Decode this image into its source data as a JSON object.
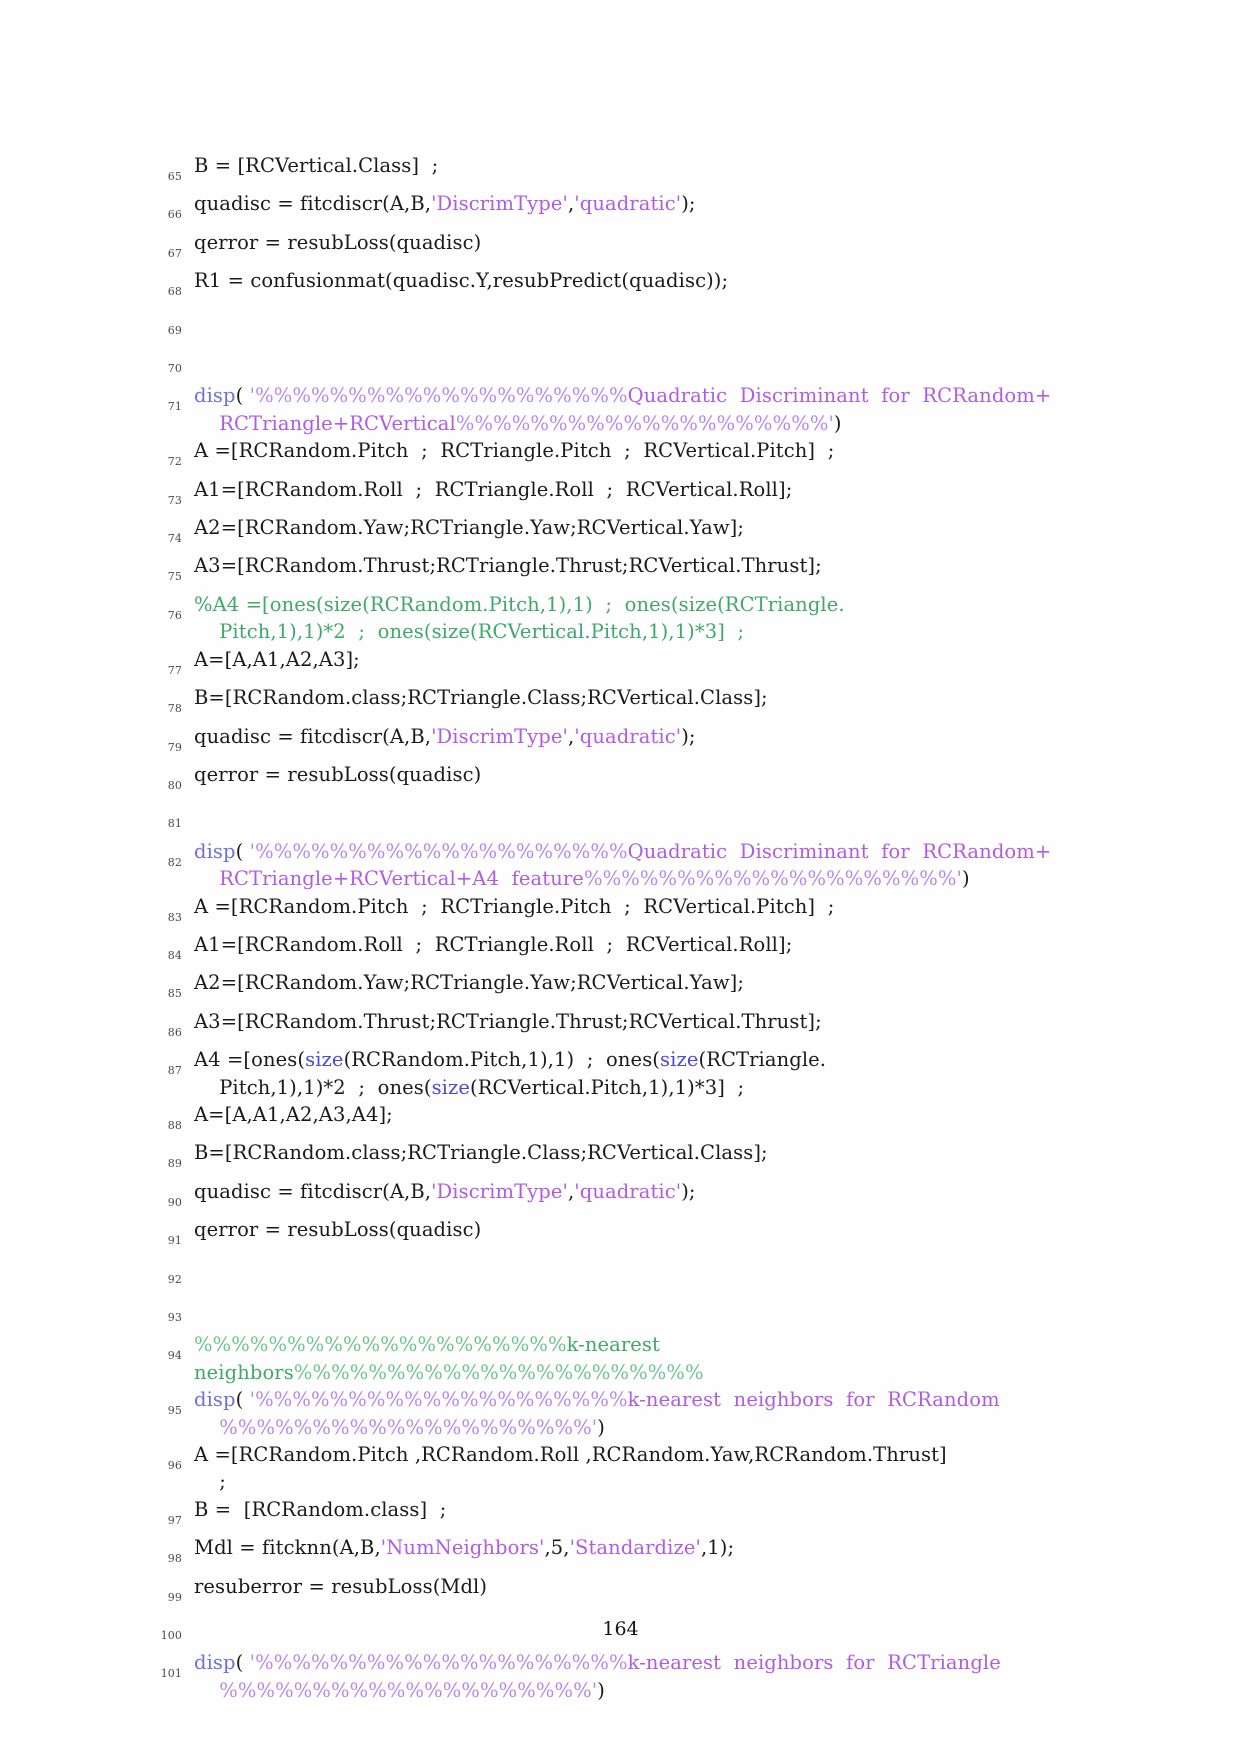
{
  "document": {
    "page_number": "164",
    "language": "MATLAB",
    "colors": {
      "text": "#1a1a1a",
      "keyword": "#4a4ad6",
      "string": "#b05ce0",
      "percent_string": "#b888e8",
      "comment": "#3fa86a",
      "function": "#6f6fe0",
      "line_number": "#4a4a4a"
    }
  },
  "listing": {
    "first_line_number": 65,
    "lines": [
      {
        "number": "65",
        "segments": [
          {
            "text": "B = [RCVertical.Class]  ;",
            "style": "plain"
          }
        ]
      },
      {
        "number": "66",
        "segments": [
          {
            "text": "quadisc = fitcdiscr(A,B,",
            "style": "plain"
          },
          {
            "text": "'DiscrimType'",
            "style": "string"
          },
          {
            "text": ",",
            "style": "plain"
          },
          {
            "text": "'quadratic'",
            "style": "string"
          },
          {
            "text": ");",
            "style": "plain"
          }
        ]
      },
      {
        "number": "67",
        "segments": [
          {
            "text": "qerror = resubLoss(quadisc)",
            "style": "plain"
          }
        ]
      },
      {
        "number": "68",
        "segments": [
          {
            "text": "R1 = confusionmat(quadisc.Y,resubPredict(quadisc));",
            "style": "plain"
          }
        ]
      },
      {
        "number": "69",
        "segments": []
      },
      {
        "number": "70",
        "segments": []
      },
      {
        "number": "71",
        "segments": [
          {
            "text": "disp",
            "style": "function"
          },
          {
            "text": "( ",
            "style": "plain"
          },
          {
            "text": "'%%%%%%%%%%%%%%%%%%%%",
            "style": "percent-string"
          },
          {
            "text": "Quadratic  Discriminant  for  RCRandom+",
            "style": "string"
          },
          {
            "text": "\nRCTriangle+RCVertical",
            "style": "string",
            "continuation": true
          },
          {
            "text": "%%%%%%%%%%%%%%%%%%%%'",
            "style": "percent-string"
          },
          {
            "text": ")",
            "style": "plain"
          }
        ],
        "wrapped_text": "disp('%%%%%%%%%%%%%%%%%%%%Quadratic Discriminant for RCRandom+RCTriangle+RCVertical%%%%%%%%%%%%%%%%%%%%')"
      },
      {
        "number": "72",
        "segments": [
          {
            "text": "A =[RCRandom.Pitch  ;  RCTriangle.Pitch  ;  RCVertical.Pitch]  ;",
            "style": "plain"
          }
        ]
      },
      {
        "number": "73",
        "segments": [
          {
            "text": "A1=[RCRandom.Roll  ;  RCTriangle.Roll  ;  RCVertical.Roll];",
            "style": "plain"
          }
        ]
      },
      {
        "number": "74",
        "segments": [
          {
            "text": "A2=[RCRandom.Yaw;RCTriangle.Yaw;RCVertical.Yaw];",
            "style": "plain"
          }
        ]
      },
      {
        "number": "75",
        "segments": [
          {
            "text": "A3=[RCRandom.Thrust;RCTriangle.Thrust;RCVertical.Thrust];",
            "style": "plain"
          }
        ]
      },
      {
        "number": "76",
        "segments": [
          {
            "text": "%A4 =[ones(size(RCRandom.Pitch,1),1)  ;  ones(size(RCTriangle.",
            "style": "comment"
          },
          {
            "text": "\nPitch,1),1)*2  ;  ones(size(RCVertical.Pitch,1),1)*3]  ;",
            "style": "comment",
            "continuation": true
          }
        ],
        "wrapped_text": "%A4 =[ones(size(RCRandom.Pitch,1),1) ; ones(size(RCTriangle.Pitch,1),1)*2 ; ones(size(RCVertical.Pitch,1),1)*3] ;"
      },
      {
        "number": "77",
        "segments": [
          {
            "text": "A=[A,A1,A2,A3];",
            "style": "plain"
          }
        ]
      },
      {
        "number": "78",
        "segments": [
          {
            "text": "B=[RCRandom.class;RCTriangle.Class;RCVertical.Class];",
            "style": "plain"
          }
        ]
      },
      {
        "number": "79",
        "segments": [
          {
            "text": "quadisc = fitcdiscr(A,B,",
            "style": "plain"
          },
          {
            "text": "'DiscrimType'",
            "style": "string"
          },
          {
            "text": ",",
            "style": "plain"
          },
          {
            "text": "'quadratic'",
            "style": "string"
          },
          {
            "text": ");",
            "style": "plain"
          }
        ]
      },
      {
        "number": "80",
        "segments": [
          {
            "text": "qerror = resubLoss(quadisc)",
            "style": "plain"
          }
        ]
      },
      {
        "number": "81",
        "segments": []
      },
      {
        "number": "82",
        "segments": [
          {
            "text": "disp",
            "style": "function"
          },
          {
            "text": "( ",
            "style": "plain"
          },
          {
            "text": "'%%%%%%%%%%%%%%%%%%%%",
            "style": "percent-string"
          },
          {
            "text": "Quadratic  Discriminant  for  RCRandom+",
            "style": "string"
          },
          {
            "text": "\nRCTriangle+RCVertical+A4  feature",
            "style": "string",
            "continuation": true
          },
          {
            "text": "%%%%%%%%%%%%%%%%%%%%'",
            "style": "percent-string"
          },
          {
            "text": ")",
            "style": "plain"
          }
        ],
        "wrapped_text": "disp('%%%%%%%%%%%%%%%%%%%%Quadratic Discriminant for RCRandom+RCTriangle+RCVertical+A4 feature%%%%%%%%%%%%%%%%%%%%')"
      },
      {
        "number": "83",
        "segments": [
          {
            "text": "A =[RCRandom.Pitch  ;  RCTriangle.Pitch  ;  RCVertical.Pitch]  ;",
            "style": "plain"
          }
        ]
      },
      {
        "number": "84",
        "segments": [
          {
            "text": "A1=[RCRandom.Roll  ;  RCTriangle.Roll  ;  RCVertical.Roll];",
            "style": "plain"
          }
        ]
      },
      {
        "number": "85",
        "segments": [
          {
            "text": "A2=[RCRandom.Yaw;RCTriangle.Yaw;RCVertical.Yaw];",
            "style": "plain"
          }
        ]
      },
      {
        "number": "86",
        "segments": [
          {
            "text": "A3=[RCRandom.Thrust;RCTriangle.Thrust;RCVertical.Thrust];",
            "style": "plain"
          }
        ]
      },
      {
        "number": "87",
        "segments": [
          {
            "text": "A4 =[ones(",
            "style": "plain"
          },
          {
            "text": "size",
            "style": "keyword"
          },
          {
            "text": "(RCRandom.Pitch,1),1)  ;  ones(",
            "style": "plain"
          },
          {
            "text": "size",
            "style": "keyword"
          },
          {
            "text": "(RCTriangle.",
            "style": "plain"
          },
          {
            "text": "\nPitch,1),1)*2  ;  ones(",
            "style": "plain",
            "continuation": true
          },
          {
            "text": "size",
            "style": "keyword"
          },
          {
            "text": "(RCVertical.Pitch,1),1)*3]  ;",
            "style": "plain"
          }
        ],
        "wrapped_text": "A4 =[ones(size(RCRandom.Pitch,1),1) ; ones(size(RCTriangle.Pitch,1),1)*2 ; ones(size(RCVertical.Pitch,1),1)*3] ;"
      },
      {
        "number": "88",
        "segments": [
          {
            "text": "A=[A,A1,A2,A3,A4];",
            "style": "plain"
          }
        ]
      },
      {
        "number": "89",
        "segments": [
          {
            "text": "B=[RCRandom.class;RCTriangle.Class;RCVertical.Class];",
            "style": "plain"
          }
        ]
      },
      {
        "number": "90",
        "segments": [
          {
            "text": "quadisc = fitcdiscr(A,B,",
            "style": "plain"
          },
          {
            "text": "'DiscrimType'",
            "style": "string"
          },
          {
            "text": ",",
            "style": "plain"
          },
          {
            "text": "'quadratic'",
            "style": "string"
          },
          {
            "text": ");",
            "style": "plain"
          }
        ]
      },
      {
        "number": "91",
        "segments": [
          {
            "text": "qerror = resubLoss(quadisc)",
            "style": "plain"
          }
        ]
      },
      {
        "number": "92",
        "segments": []
      },
      {
        "number": "93",
        "segments": []
      },
      {
        "number": "94",
        "segments": [
          {
            "text": "%%%%%%%%%%%%%%%%%%%%",
            "style": "comment-percent"
          },
          {
            "text": "k-nearest  neighbors",
            "style": "comment"
          },
          {
            "text": "%%%%%%%%%%%%%%%%%%%%%%",
            "style": "comment-percent"
          }
        ]
      },
      {
        "number": "95",
        "segments": [
          {
            "text": "disp",
            "style": "function"
          },
          {
            "text": "( ",
            "style": "plain"
          },
          {
            "text": "'%%%%%%%%%%%%%%%%%%%%",
            "style": "percent-string"
          },
          {
            "text": "k-nearest  neighbors  for  RCRandom",
            "style": "string"
          },
          {
            "text": "\n",
            "style": "plain",
            "continuation": true
          },
          {
            "text": "%%%%%%%%%%%%%%%%%%%%'",
            "style": "percent-string"
          },
          {
            "text": ")",
            "style": "plain"
          }
        ],
        "wrapped_text": "disp('%%%%%%%%%%%%%%%%%%%%k-nearest neighbors for RCRandom%%%%%%%%%%%%%%%%%%%%')"
      },
      {
        "number": "96",
        "segments": [
          {
            "text": "A =[RCRandom.Pitch ,RCRandom.Roll ,RCRandom.Yaw,RCRandom.Thrust]",
            "style": "plain"
          },
          {
            "text": "\n;",
            "style": "plain",
            "continuation": true
          }
        ],
        "wrapped_text": "A =[RCRandom.Pitch ,RCRandom.Roll ,RCRandom.Yaw,RCRandom.Thrust] ;"
      },
      {
        "number": "97",
        "segments": [
          {
            "text": "B =  [RCRandom.class]  ;",
            "style": "plain"
          }
        ]
      },
      {
        "number": "98",
        "segments": [
          {
            "text": "Mdl = fitcknn(A,B,",
            "style": "plain"
          },
          {
            "text": "'NumNeighbors'",
            "style": "string"
          },
          {
            "text": ",5,",
            "style": "plain"
          },
          {
            "text": "'Standardize'",
            "style": "string"
          },
          {
            "text": ",1);",
            "style": "plain"
          }
        ]
      },
      {
        "number": "99",
        "segments": [
          {
            "text": "resuberror = resubLoss(Mdl)",
            "style": "plain"
          }
        ]
      },
      {
        "number": "100",
        "segments": []
      },
      {
        "number": "101",
        "segments": [
          {
            "text": "disp",
            "style": "function"
          },
          {
            "text": "( ",
            "style": "plain"
          },
          {
            "text": "'%%%%%%%%%%%%%%%%%%%%",
            "style": "percent-string"
          },
          {
            "text": "k-nearest  neighbors  for  RCTriangle",
            "style": "string"
          },
          {
            "text": "\n",
            "style": "plain",
            "continuation": true
          },
          {
            "text": "%%%%%%%%%%%%%%%%%%%%'",
            "style": "percent-string"
          },
          {
            "text": ")",
            "style": "plain"
          }
        ],
        "wrapped_text": "disp('%%%%%%%%%%%%%%%%%%%%k-nearest neighbors for RCTriangle%%%%%%%%%%%%%%%%%%%%')"
      }
    ]
  }
}
